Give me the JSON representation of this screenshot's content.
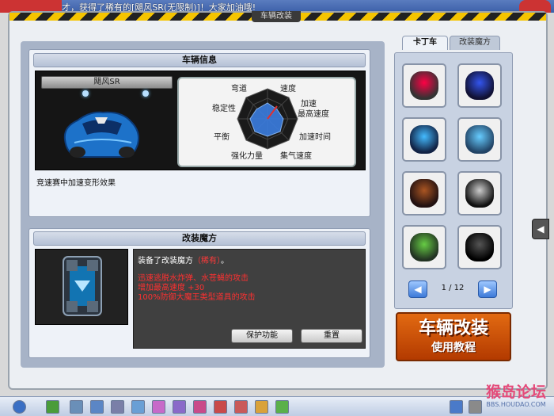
{
  "ticker": "才，获得了稀有的[飓风SR(无限制)]！大家加油哦!",
  "frame_title": "车辆改装",
  "vehicle_info": {
    "heading": "车辆信息",
    "car_name": "飓风SR",
    "description": "竞速赛中加速变形效果",
    "stats": [
      "弯道",
      "速度",
      "加速",
      "最高速度",
      "加速时间",
      "集气速度",
      "强化力量",
      "平衡",
      "稳定性"
    ]
  },
  "mod_magic": {
    "heading": "改装魔方",
    "equipped_prefix": "装备了改装魔方",
    "equipped_rarity": "（稀有）",
    "equipped_suffix": "。",
    "effects": [
      "迅速逃脱水炸弹、水苍蝇的攻击",
      "增加最高速度 +30",
      "100%防御大魔王类型道具的攻击"
    ],
    "protect_button": "保护功能",
    "reset_button": "重置"
  },
  "tabs": {
    "kart": "卡丁车",
    "mod": "改装魔方"
  },
  "pager": {
    "prev": "◀",
    "text": "1 / 12",
    "next": "▶"
  },
  "big_button": {
    "line1": "车辆改装",
    "line2": "使用教程"
  },
  "side_arrow": "◀",
  "watermark": {
    "line1": "猴岛论坛",
    "line2": "BBS.HOUDAO.COM"
  },
  "colors": {
    "accent_orange": "#d5520a",
    "panel_blue": "#a7b3c7",
    "highlight_red": "#ff3030"
  },
  "kart_slots": [
    "red-kart",
    "blue-kart",
    "blue-white-kart",
    "small-blue-kart",
    "black-red-kart",
    "black-white-kart",
    "green-kart",
    "dark-shark-kart"
  ]
}
